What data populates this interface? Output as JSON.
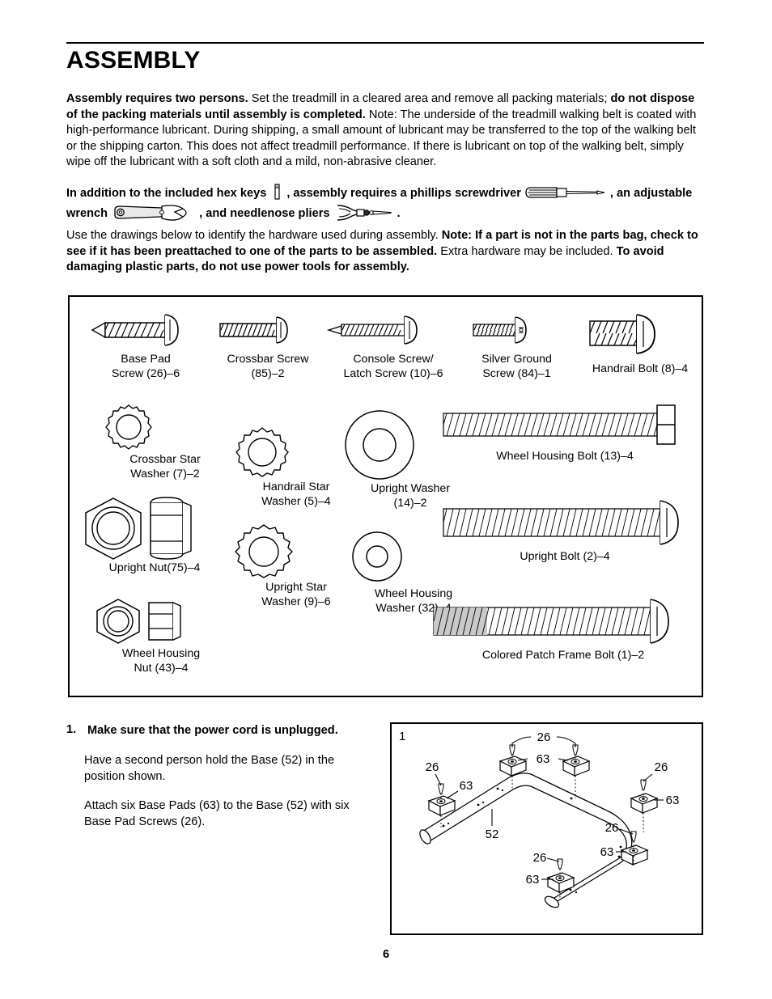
{
  "document": {
    "title": "ASSEMBLY",
    "page_number": "6"
  },
  "paragraphs": {
    "intro": {
      "bold_1": "Assembly requires two persons.",
      "text_1": " Set the treadmill in a cleared area and remove all packing materials; ",
      "bold_2": "do not dispose of the packing materials until assembly is completed.",
      "text_2": " Note: The underside of the treadmill walking belt is coated with high-performance lubricant. During shipping, a small amount of lubricant may be transferred to the top of the walking belt or the shipping carton. This does not affect treadmill performance. If there is lubricant on top of the walking belt, simply wipe off the lubricant with a soft cloth and a mild, non-abrasive cleaner."
    },
    "tools": {
      "text_1": "In addition to the included hex keys",
      "text_2": ", assembly requires a phillips screwdriver",
      "text_3": ", an adjustable wrench",
      "text_4": ", and needlenose pliers",
      "text_5": "."
    },
    "hardware": {
      "text_1": "Use the drawings below to identify the hardware used during assembly. ",
      "bold_1": "Note: If a part is not in the parts bag, check to see if it has been preattached to one of the parts to be assembled.",
      "text_2": " Extra hardware may be included. ",
      "bold_2": "To avoid damaging plastic parts, do not use power tools for assembly."
    }
  },
  "tool_icons": {
    "hex_key": "hex-key-icon",
    "screwdriver": "phillips-screwdriver-icon",
    "wrench": "adjustable-wrench-icon",
    "pliers": "needlenose-pliers-icon"
  },
  "hardware_parts": [
    {
      "id": "base-pad-screw",
      "label": "Base Pad\nScrew (26)–6",
      "part_no": "26",
      "qty": "6",
      "art": "screw-pointed"
    },
    {
      "id": "crossbar-screw",
      "label": "Crossbar Screw\n(85)–2",
      "part_no": "85",
      "qty": "2",
      "art": "screw-flat"
    },
    {
      "id": "console-latch-screw",
      "label": "Console Screw/\nLatch Screw (10)–6",
      "part_no": "10",
      "qty": "6",
      "art": "screw-sharp"
    },
    {
      "id": "silver-ground-screw",
      "label": "Silver Ground\nScrew (84)–1",
      "part_no": "84",
      "qty": "1",
      "art": "screw-small"
    },
    {
      "id": "handrail-bolt",
      "label": "Handrail Bolt (8)–4",
      "part_no": "8",
      "qty": "4",
      "art": "bolt-short"
    },
    {
      "id": "crossbar-star-washer",
      "label": "Crossbar Star\nWasher (7)–2",
      "part_no": "7",
      "qty": "2",
      "art": "star-washer"
    },
    {
      "id": "handrail-star-washer",
      "label": "Handrail Star\nWasher (5)–4",
      "part_no": "5",
      "qty": "4",
      "art": "star-washer"
    },
    {
      "id": "upright-washer",
      "label": "Upright Washer\n(14)–2",
      "part_no": "14",
      "qty": "2",
      "art": "flat-washer"
    },
    {
      "id": "upright-nut",
      "label": "Upright Nut(75)–4",
      "part_no": "75",
      "qty": "4",
      "art": "nut-pair"
    },
    {
      "id": "upright-star-washer",
      "label": "Upright Star\nWasher (9)–6",
      "part_no": "9",
      "qty": "6",
      "art": "star-washer"
    },
    {
      "id": "wheel-housing-washer",
      "label": "Wheel Housing\nWasher (32)–4",
      "part_no": "32",
      "qty": "4",
      "art": "flat-washer"
    },
    {
      "id": "wheel-housing-nut",
      "label": "Wheel Housing\nNut (43)–4",
      "part_no": "43",
      "qty": "4",
      "art": "nut-pair"
    },
    {
      "id": "wheel-housing-bolt",
      "label": "Wheel Housing Bolt (13)–4",
      "part_no": "13",
      "qty": "4",
      "art": "bolt-long-hex"
    },
    {
      "id": "upright-bolt",
      "label": "Upright Bolt (2)–4",
      "part_no": "2",
      "qty": "4",
      "art": "bolt-long-round"
    },
    {
      "id": "colored-patch-frame-bolt",
      "label": "Colored Patch Frame Bolt (1)–2",
      "part_no": "1",
      "qty": "2",
      "art": "bolt-long-patch"
    }
  ],
  "step": {
    "number": "1.",
    "heading": "Make sure that the power cord is unplugged.",
    "paragraph_1": "Have a second person hold the Base (52) in the position shown.",
    "paragraph_2": "Attach six Base Pads (63) to the Base (52) with six Base Pad Screws (26).",
    "panel_number": "1",
    "callouts": [
      {
        "id": "callout-26-top-left",
        "text": "26"
      },
      {
        "id": "callout-63-top-mid",
        "text": "63"
      },
      {
        "id": "callout-26-left",
        "text": "26"
      },
      {
        "id": "callout-63-left",
        "text": "63"
      },
      {
        "id": "callout-26-right",
        "text": "26"
      },
      {
        "id": "callout-63-right",
        "text": "63"
      },
      {
        "id": "callout-52-base",
        "text": "52"
      },
      {
        "id": "callout-26-mid-right",
        "text": "26"
      },
      {
        "id": "callout-63-mid-right",
        "text": "63"
      },
      {
        "id": "callout-26-bottom",
        "text": "26"
      },
      {
        "id": "callout-63-bottom",
        "text": "63"
      }
    ]
  },
  "colors": {
    "ink": "#000000",
    "paper": "#ffffff",
    "shade": "#c9c9c9"
  }
}
